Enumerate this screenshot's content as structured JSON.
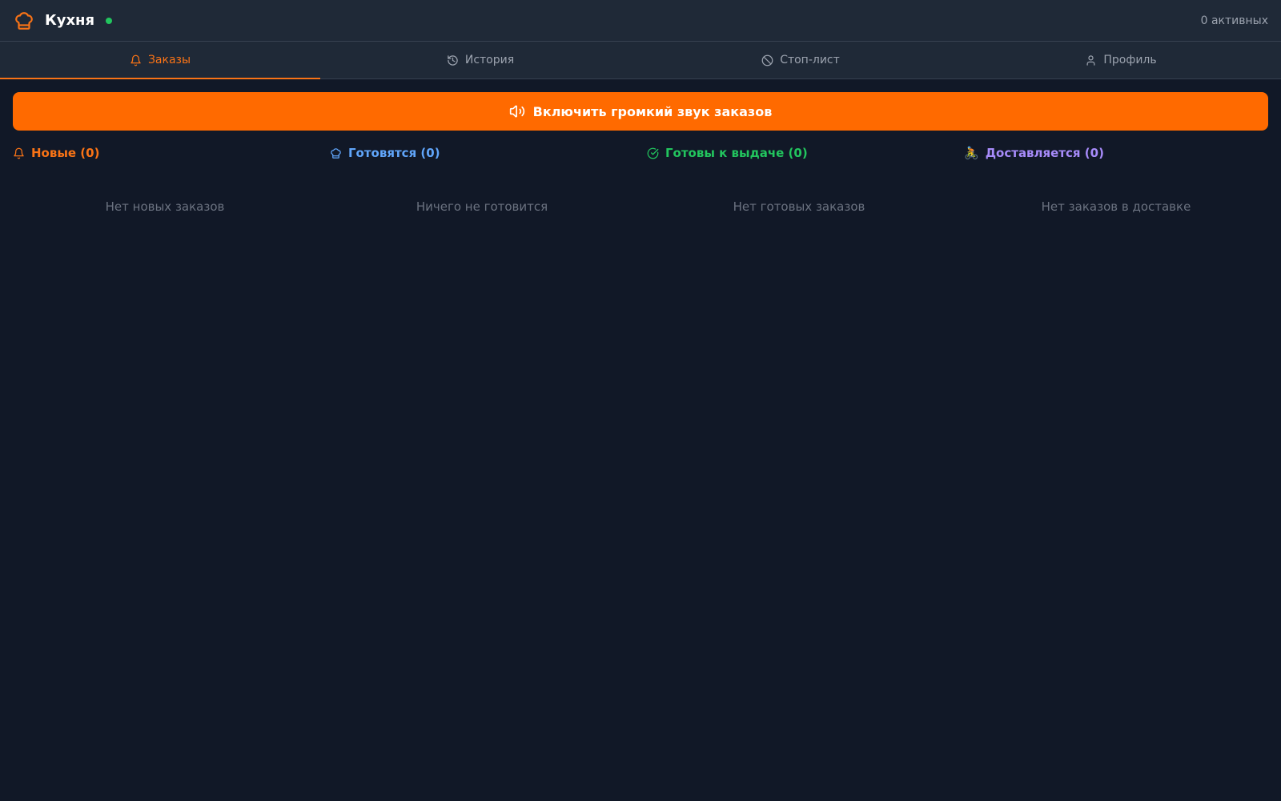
{
  "app": {
    "title": "Кухня",
    "online": true,
    "active_count": "0 активных"
  },
  "tabs": [
    {
      "label": "Заказы",
      "icon": "bell-icon",
      "active": true
    },
    {
      "label": "История",
      "icon": "history-icon",
      "active": false
    },
    {
      "label": "Стоп-лист",
      "icon": "ban-icon",
      "active": false
    },
    {
      "label": "Профиль",
      "icon": "user-icon",
      "active": false
    }
  ],
  "sound_button": {
    "label": "Включить громкий звук заказов",
    "icon": "volume-icon"
  },
  "columns": [
    {
      "title": "Новые (0)",
      "empty": "Нет новых заказов",
      "icon": "bell-icon",
      "color": "#f97316"
    },
    {
      "title": "Готовятся (0)",
      "empty": "Ничего не готовится",
      "icon": "chef-hat-icon",
      "color": "#60a5fa"
    },
    {
      "title": "Готовы к выдаче (0)",
      "empty": "Нет готовых заказов",
      "icon": "check-circle-icon",
      "color": "#22c55e"
    },
    {
      "title": "Доставляется (0)",
      "empty": "Нет заказов в доставке",
      "icon": "cyclist-icon",
      "color": "#a78bfa"
    }
  ],
  "colors": {
    "accent": "#ff6a00",
    "background": "#111827",
    "header": "#1f2937",
    "online": "#22c55e"
  }
}
